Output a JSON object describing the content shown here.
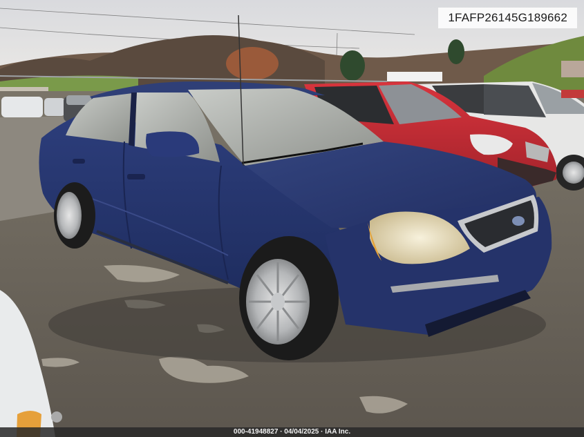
{
  "photo": {
    "vin": "1FAFP26145G189662",
    "footer": "000-41948827 · 04/04/2025 · IAA Inc."
  }
}
